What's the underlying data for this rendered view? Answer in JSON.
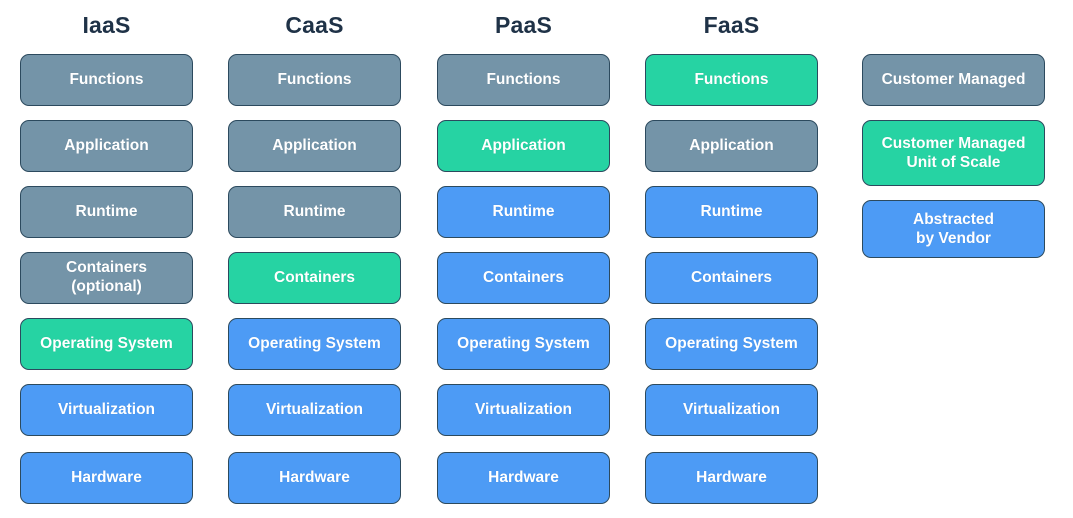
{
  "diagram": {
    "title_row": [
      "IaaS",
      "CaaS",
      "PaaS",
      "FaaS"
    ],
    "layers": [
      "Functions",
      "Application",
      "Runtime",
      "Containers",
      "Operating System",
      "Virtualization",
      "Hardware"
    ],
    "columns": [
      {
        "name": "IaaS",
        "cells": [
          {
            "label": "Functions",
            "fill": "gray"
          },
          {
            "label": "Application",
            "fill": "gray"
          },
          {
            "label": "Runtime",
            "fill": "gray"
          },
          {
            "label": "Containers\n(optional)",
            "fill": "gray"
          },
          {
            "label": "Operating System",
            "fill": "green"
          },
          {
            "label": "Virtualization",
            "fill": "blue"
          },
          {
            "label": "Hardware",
            "fill": "blue"
          }
        ]
      },
      {
        "name": "CaaS",
        "cells": [
          {
            "label": "Functions",
            "fill": "gray"
          },
          {
            "label": "Application",
            "fill": "gray"
          },
          {
            "label": "Runtime",
            "fill": "gray"
          },
          {
            "label": "Containers",
            "fill": "green"
          },
          {
            "label": "Operating System",
            "fill": "blue"
          },
          {
            "label": "Virtualization",
            "fill": "blue"
          },
          {
            "label": "Hardware",
            "fill": "blue"
          }
        ]
      },
      {
        "name": "PaaS",
        "cells": [
          {
            "label": "Functions",
            "fill": "gray"
          },
          {
            "label": "Application",
            "fill": "green"
          },
          {
            "label": "Runtime",
            "fill": "blue"
          },
          {
            "label": "Containers",
            "fill": "blue"
          },
          {
            "label": "Operating System",
            "fill": "blue"
          },
          {
            "label": "Virtualization",
            "fill": "blue"
          },
          {
            "label": "Hardware",
            "fill": "blue"
          }
        ]
      },
      {
        "name": "FaaS",
        "cells": [
          {
            "label": "Functions",
            "fill": "green"
          },
          {
            "label": "Application",
            "fill": "gray"
          },
          {
            "label": "Runtime",
            "fill": "blue"
          },
          {
            "label": "Containers",
            "fill": "blue"
          },
          {
            "label": "Operating System",
            "fill": "blue"
          },
          {
            "label": "Virtualization",
            "fill": "blue"
          },
          {
            "label": "Hardware",
            "fill": "blue"
          }
        ]
      }
    ],
    "legend": [
      {
        "label": "Customer Managed",
        "fill": "gray"
      },
      {
        "label": "Customer Managed\nUnit of Scale",
        "fill": "green"
      },
      {
        "label": "Abstracted\nby Vendor",
        "fill": "blue"
      }
    ],
    "colors": {
      "gray": "#7494a8",
      "green": "#26d3a3",
      "blue": "#4d9bf5",
      "border": "#2c4a5e",
      "header_text": "#1f3247",
      "box_text": "#ffffff",
      "background": "#ffffff"
    }
  }
}
